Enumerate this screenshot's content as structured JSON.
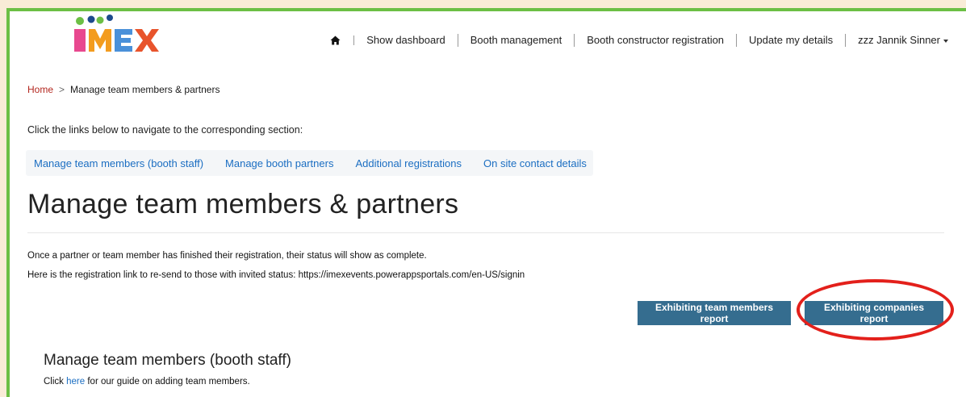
{
  "brand": {
    "logo_text": "IMEX",
    "colors": {
      "i": "#e8488f",
      "m": "#f39c1f",
      "e": "#4a90d9",
      "x": "#e8542c",
      "dot_green": "#6cbf45",
      "dot_blue": "#1d4a8c",
      "dot_pink": "#e8488f",
      "dot_orange": "#f39c1f"
    }
  },
  "nav": {
    "home_icon": "home-icon",
    "items": [
      "Show dashboard",
      "Booth management",
      "Booth constructor registration",
      "Update my details"
    ],
    "user_menu": "zzz Jannik Sinner"
  },
  "breadcrumb": {
    "home": "Home",
    "separator": ">",
    "current": "Manage team members & partners"
  },
  "instruction": "Click the links below to navigate to the corresponding section:",
  "section_links": [
    "Manage team members (booth staff)",
    "Manage booth partners",
    "Additional registrations",
    "On site contact details"
  ],
  "page_title": "Manage team members & partners",
  "info": {
    "line1": "Once a partner or team member has finished their registration, their status will show as complete.",
    "line2": "Here is the registration link to re-send to those with invited status: https://imexevents.powerappsportals.com/en-US/signin"
  },
  "buttons": {
    "team_report": "Exhibiting team members report",
    "companies_report": "Exhibiting companies report"
  },
  "team_section": {
    "title": "Manage team members (booth staff)",
    "guide_prefix": "Click ",
    "guide_link": "here",
    "guide_suffix": " for our guide on adding team members."
  },
  "colors": {
    "accent_button": "#356d8f",
    "link": "#1b6ec2",
    "breadcrumb_home": "#b3261e",
    "frame_border": "#6cbf45",
    "annotation": "#e3201b"
  }
}
